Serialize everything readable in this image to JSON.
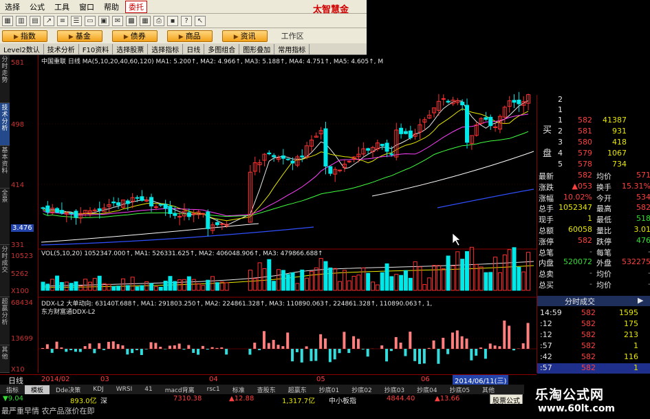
{
  "menu": {
    "items": [
      "选择",
      "公式",
      "工具",
      "窗口",
      "帮助"
    ],
    "hot_item": "委托",
    "brand": "太智慧金"
  },
  "category_tabs": [
    "指数",
    "基金",
    "债券",
    "商品",
    "资讯"
  ],
  "workarea_label": "工作区",
  "funcbar": [
    "Level2数认",
    "技术分析",
    "F10资料",
    "选择股票",
    "选择指标",
    "日线",
    "多图组合",
    "图形叠加",
    "常用指标"
  ],
  "left_tabs": [
    "分时走势",
    "技术分析",
    "基本资料",
    "全景",
    "分时成交",
    "超赢分析",
    "其他"
  ],
  "price_axis": {
    "labels": [
      "581",
      "498",
      "414",
      "3.476",
      "331"
    ],
    "vol_labels": [
      "10523",
      "5262",
      "X100"
    ],
    "ddx_labels": [
      "68434",
      "13699",
      "X10"
    ]
  },
  "legends": {
    "ma": "中国重联 日线 MA(5,10,20,40,60,120) MA1: 5.200↑, MA2: 4.966↑, MA3: 5.188↑, MA4: 4.751↑, MA5: 4.605↑, M",
    "vol": "VOL(5,10,20) 1052347.000↑, MA1: 526331.625↑, MA2: 406048.906↑, MA3: 479866.688↑",
    "ddx": "DDX-L2 大单动向: 63140T.688↑, MA1: 291803.250↑, MA2: 224861.328↑, MA3: 110890.063↑, 224861.328↑, 110890.063↑, 1,",
    "ddx2": "东方财富通DDX-L2"
  },
  "quote": {
    "top_rows": [
      {
        "label": "",
        "idx": "2",
        "price": "",
        "vol": ""
      },
      {
        "label": "",
        "idx": "1",
        "price": "",
        "vol": ""
      }
    ],
    "buy_label": "买",
    "buy_rows": [
      {
        "idx": "1",
        "price": "582",
        "vol": "41387"
      },
      {
        "idx": "2",
        "price": "581",
        "vol": "931"
      },
      {
        "idx": "3",
        "price": "580",
        "vol": "418"
      },
      {
        "idx": "4",
        "price": "579",
        "vol": "1067"
      },
      {
        "idx": "5",
        "price": "578",
        "vol": "734"
      }
    ],
    "pan_label": "盘",
    "stats": [
      {
        "k1": "最新",
        "v1": "582",
        "k2": "均价",
        "v2": "571"
      },
      {
        "k1": "涨跌",
        "v1": "▲053",
        "k2": "换手",
        "v2": "15.31%"
      },
      {
        "k1": "涨幅",
        "v1": "10.02%",
        "k2": "今开",
        "v2": "534"
      },
      {
        "k1": "总手",
        "v1": "1052347",
        "k2": "最高",
        "v2": "582"
      },
      {
        "k1": "现手",
        "v1": "1",
        "k2": "最低",
        "v2": "518"
      },
      {
        "k1": "总额",
        "v1": "60058",
        "k2": "量比",
        "v2": "3.01"
      },
      {
        "k1": "涨停",
        "v1": "582",
        "k2": "跌停",
        "v2": "476"
      },
      {
        "k1": "总笔",
        "v1": "-",
        "k2": "每笔",
        "v2": "-"
      },
      {
        "k1": "内盘",
        "v1": "520072",
        "k2": "外盘",
        "v2": "532275"
      },
      {
        "k1": "总卖",
        "v1": "-",
        "k2": "均价",
        "v2": "-"
      },
      {
        "k1": "总买",
        "v1": "-",
        "k2": "均价",
        "v2": "-"
      }
    ],
    "trades_header": "分时成交",
    "trades": [
      {
        "time": "14:59",
        "price": "582",
        "vol": "1595"
      },
      {
        "time": ":12",
        "price": "582",
        "vol": "175"
      },
      {
        "time": ":12",
        "price": "582",
        "vol": "213"
      },
      {
        "time": ":57",
        "price": "582",
        "vol": "1"
      },
      {
        "time": ":42",
        "price": "582",
        "vol": "116"
      },
      {
        "time": ":57",
        "price": "582",
        "vol": "1"
      }
    ]
  },
  "period_bar": {
    "label": "日线",
    "dates": [
      "2014/02",
      "03",
      "04",
      "05",
      "06",
      "2014/06/11(三)"
    ]
  },
  "bottom_tabs": [
    "指标",
    "模板",
    "Dde决策",
    "KDJ",
    "WRSI",
    "41",
    "macd背离",
    "rsc1",
    "标准",
    "查股东",
    "超赢东",
    "抄底01",
    "抄底02",
    "抄底03",
    "抄底04",
    "抄底05",
    "其他"
  ],
  "index_bar": {
    "sh_change": "▼9.04",
    "sh_amount": "893.0亿",
    "sz_label": "深",
    "sz_index": "7310.38",
    "sz_change": "▲12.88",
    "sz_amount": "1,317.7亿",
    "sme_label": "中小板指",
    "sme_index": "4844.40",
    "sme_change": "▲13.66",
    "formula_btn": "股票公式"
  },
  "news": "最严重早情 农产品涨价在即",
  "watermark": {
    "title": "乐淘公式网",
    "url": "www.60lt.com"
  },
  "colors": {
    "up": "#ff3030",
    "down": "#00e8e8",
    "ma5": "#e8e8e8",
    "ma10": "#e8e800",
    "ma20": "#ff40ff",
    "ma40": "#40ff40",
    "ma60": "#ffffff",
    "ma120": "#3050ff"
  }
}
